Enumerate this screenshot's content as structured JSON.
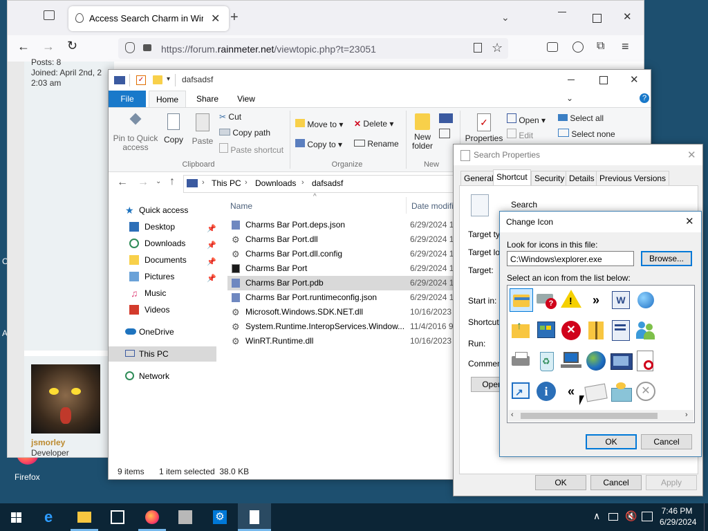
{
  "desktop": {
    "firefox_label": "Firefox",
    "edge_letters": [
      "C",
      "A"
    ]
  },
  "firefox": {
    "tab_title": "Access Search Charm in Windo",
    "url_prefix": "https://forum.",
    "url_domain": "rainmeter.net",
    "url_suffix": "/viewtopic.php?t=23051",
    "post_lines": [
      "Posts: 8",
      "Joined: April 2nd, 2",
      "2:03 am"
    ],
    "user_name": "jsmorley",
    "user_role": "Developer"
  },
  "explorer": {
    "title": "dafsadsf",
    "tabs": [
      "File",
      "Home",
      "Share",
      "View"
    ],
    "ribbon": {
      "pin_label": "Pin to Quick access",
      "copy": "Copy",
      "paste": "Paste",
      "cut": "Cut",
      "copy_path": "Copy path",
      "paste_shortcut": "Paste shortcut",
      "clipboard_group": "Clipboard",
      "move_to": "Move to",
      "copy_to": "Copy to",
      "delete": "Delete",
      "rename": "Rename",
      "organize_group": "Organize",
      "new_folder": "New folder",
      "new_group": "New",
      "properties": "Properties",
      "open": "Open",
      "edit": "Edit",
      "select_all": "Select all",
      "select_none": "Select none"
    },
    "breadcrumb": [
      "This PC",
      "Downloads",
      "dafsadsf"
    ],
    "nav": {
      "quick_access": "Quick access",
      "items": [
        "Desktop",
        "Downloads",
        "Documents",
        "Pictures",
        "Music",
        "Videos"
      ],
      "onedrive": "OneDrive",
      "this_pc": "This PC",
      "network": "Network"
    },
    "columns": {
      "name": "Name",
      "date": "Date modifi"
    },
    "files": [
      {
        "name": "Charms Bar Port.deps.json",
        "date": "6/29/2024 1",
        "icon": "file-icon"
      },
      {
        "name": "Charms Bar Port.dll",
        "date": "6/29/2024 1",
        "icon": "gear-icon"
      },
      {
        "name": "Charms Bar Port.dll.config",
        "date": "6/29/2024 1",
        "icon": "gear-icon"
      },
      {
        "name": "Charms Bar Port",
        "date": "6/29/2024 1",
        "icon": "app-icon"
      },
      {
        "name": "Charms Bar Port.pdb",
        "date": "6/29/2024 1",
        "icon": "file-icon"
      },
      {
        "name": "Charms Bar Port.runtimeconfig.json",
        "date": "6/29/2024 1",
        "icon": "file-icon"
      },
      {
        "name": "Microsoft.Windows.SDK.NET.dll",
        "date": "10/16/2023",
        "icon": "gear-icon"
      },
      {
        "name": "System.Runtime.InteropServices.Window...",
        "date": "11/4/2016 9",
        "icon": "gear-icon"
      },
      {
        "name": "WinRT.Runtime.dll",
        "date": "10/16/2023",
        "icon": "gear-icon"
      }
    ],
    "status_count": "9 items",
    "status_selected": "1 item selected  38.0 KB"
  },
  "search_props": {
    "title": "Search Properties",
    "tabs": [
      "General",
      "Shortcut",
      "Security",
      "Details",
      "Previous Versions"
    ],
    "name": "Search",
    "labels": [
      "Target typ",
      "Target loc",
      "Target:",
      "Start in:",
      "Shortcut k",
      "Run:",
      "Comment:"
    ],
    "open_btn": "Open",
    "ok": "OK",
    "cancel": "Cancel",
    "apply": "Apply"
  },
  "change_icon": {
    "title": "Change Icon",
    "look_label": "Look for icons in this file:",
    "file_value": "C:\\Windows\\explorer.exe",
    "browse": "Browse...",
    "select_label": "Select an icon from the list below:",
    "ok": "OK",
    "cancel": "Cancel"
  },
  "taskbar": {
    "time": "7:46 PM",
    "date": "6/29/2024"
  },
  "colors": {
    "accent": "#0078d7",
    "selection": "#cce8ff",
    "selected_gray": "#d9d9d9"
  }
}
